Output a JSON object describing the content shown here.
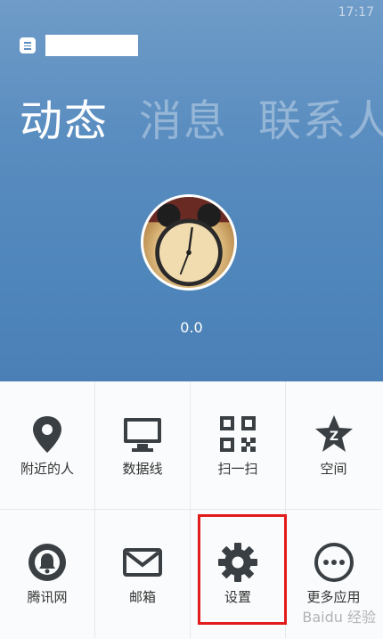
{
  "status_bar": {
    "time": "17:17"
  },
  "header": {
    "tabs": [
      {
        "label": "动态",
        "active": true
      },
      {
        "label": "消息",
        "active": false
      },
      {
        "label": "联系人",
        "active": false
      }
    ]
  },
  "profile": {
    "score": "0.0"
  },
  "grid": {
    "items": [
      {
        "label": "附近的人",
        "icon": "location-pin-icon"
      },
      {
        "label": "数据线",
        "icon": "monitor-icon"
      },
      {
        "label": "扫一扫",
        "icon": "qr-code-icon"
      },
      {
        "label": "空间",
        "icon": "qzone-star-icon"
      },
      {
        "label": "腾讯网",
        "icon": "tencent-news-icon"
      },
      {
        "label": "邮箱",
        "icon": "mail-icon"
      },
      {
        "label": "设置",
        "icon": "gear-icon"
      },
      {
        "label": "更多应用",
        "icon": "more-apps-icon"
      }
    ]
  },
  "highlight_color": "#e21b1b",
  "watermark": "Baidu 经验"
}
